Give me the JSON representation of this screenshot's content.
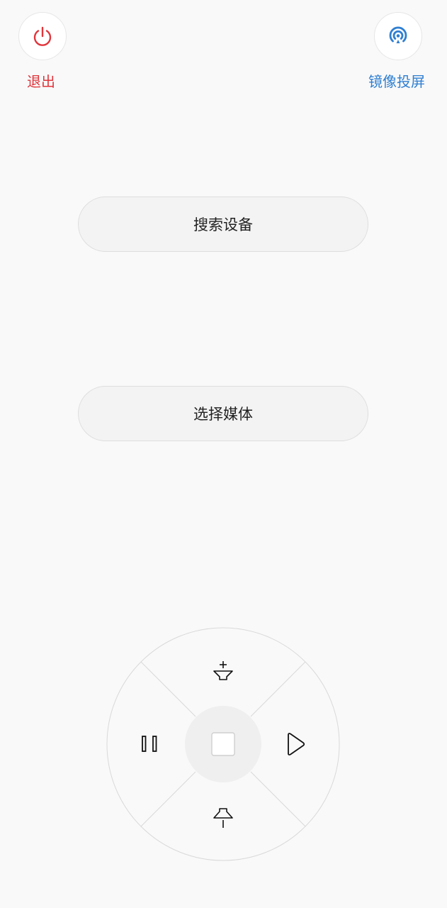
{
  "top_bar": {
    "exit_label": "退出",
    "exit_icon": "power-icon",
    "exit_color": "#e0353b",
    "mirror_label": "镜像投屏",
    "mirror_icon": "cast-signal-icon",
    "mirror_color": "#2f7fd1"
  },
  "actions": {
    "search_devices_label": "搜索设备",
    "select_media_label": "选择媒体"
  },
  "remote": {
    "up_icon": "volume-up-icon",
    "down_icon": "volume-down-icon",
    "left_icon": "pause-icon",
    "right_icon": "play-icon",
    "center_icon": "stop-icon"
  }
}
